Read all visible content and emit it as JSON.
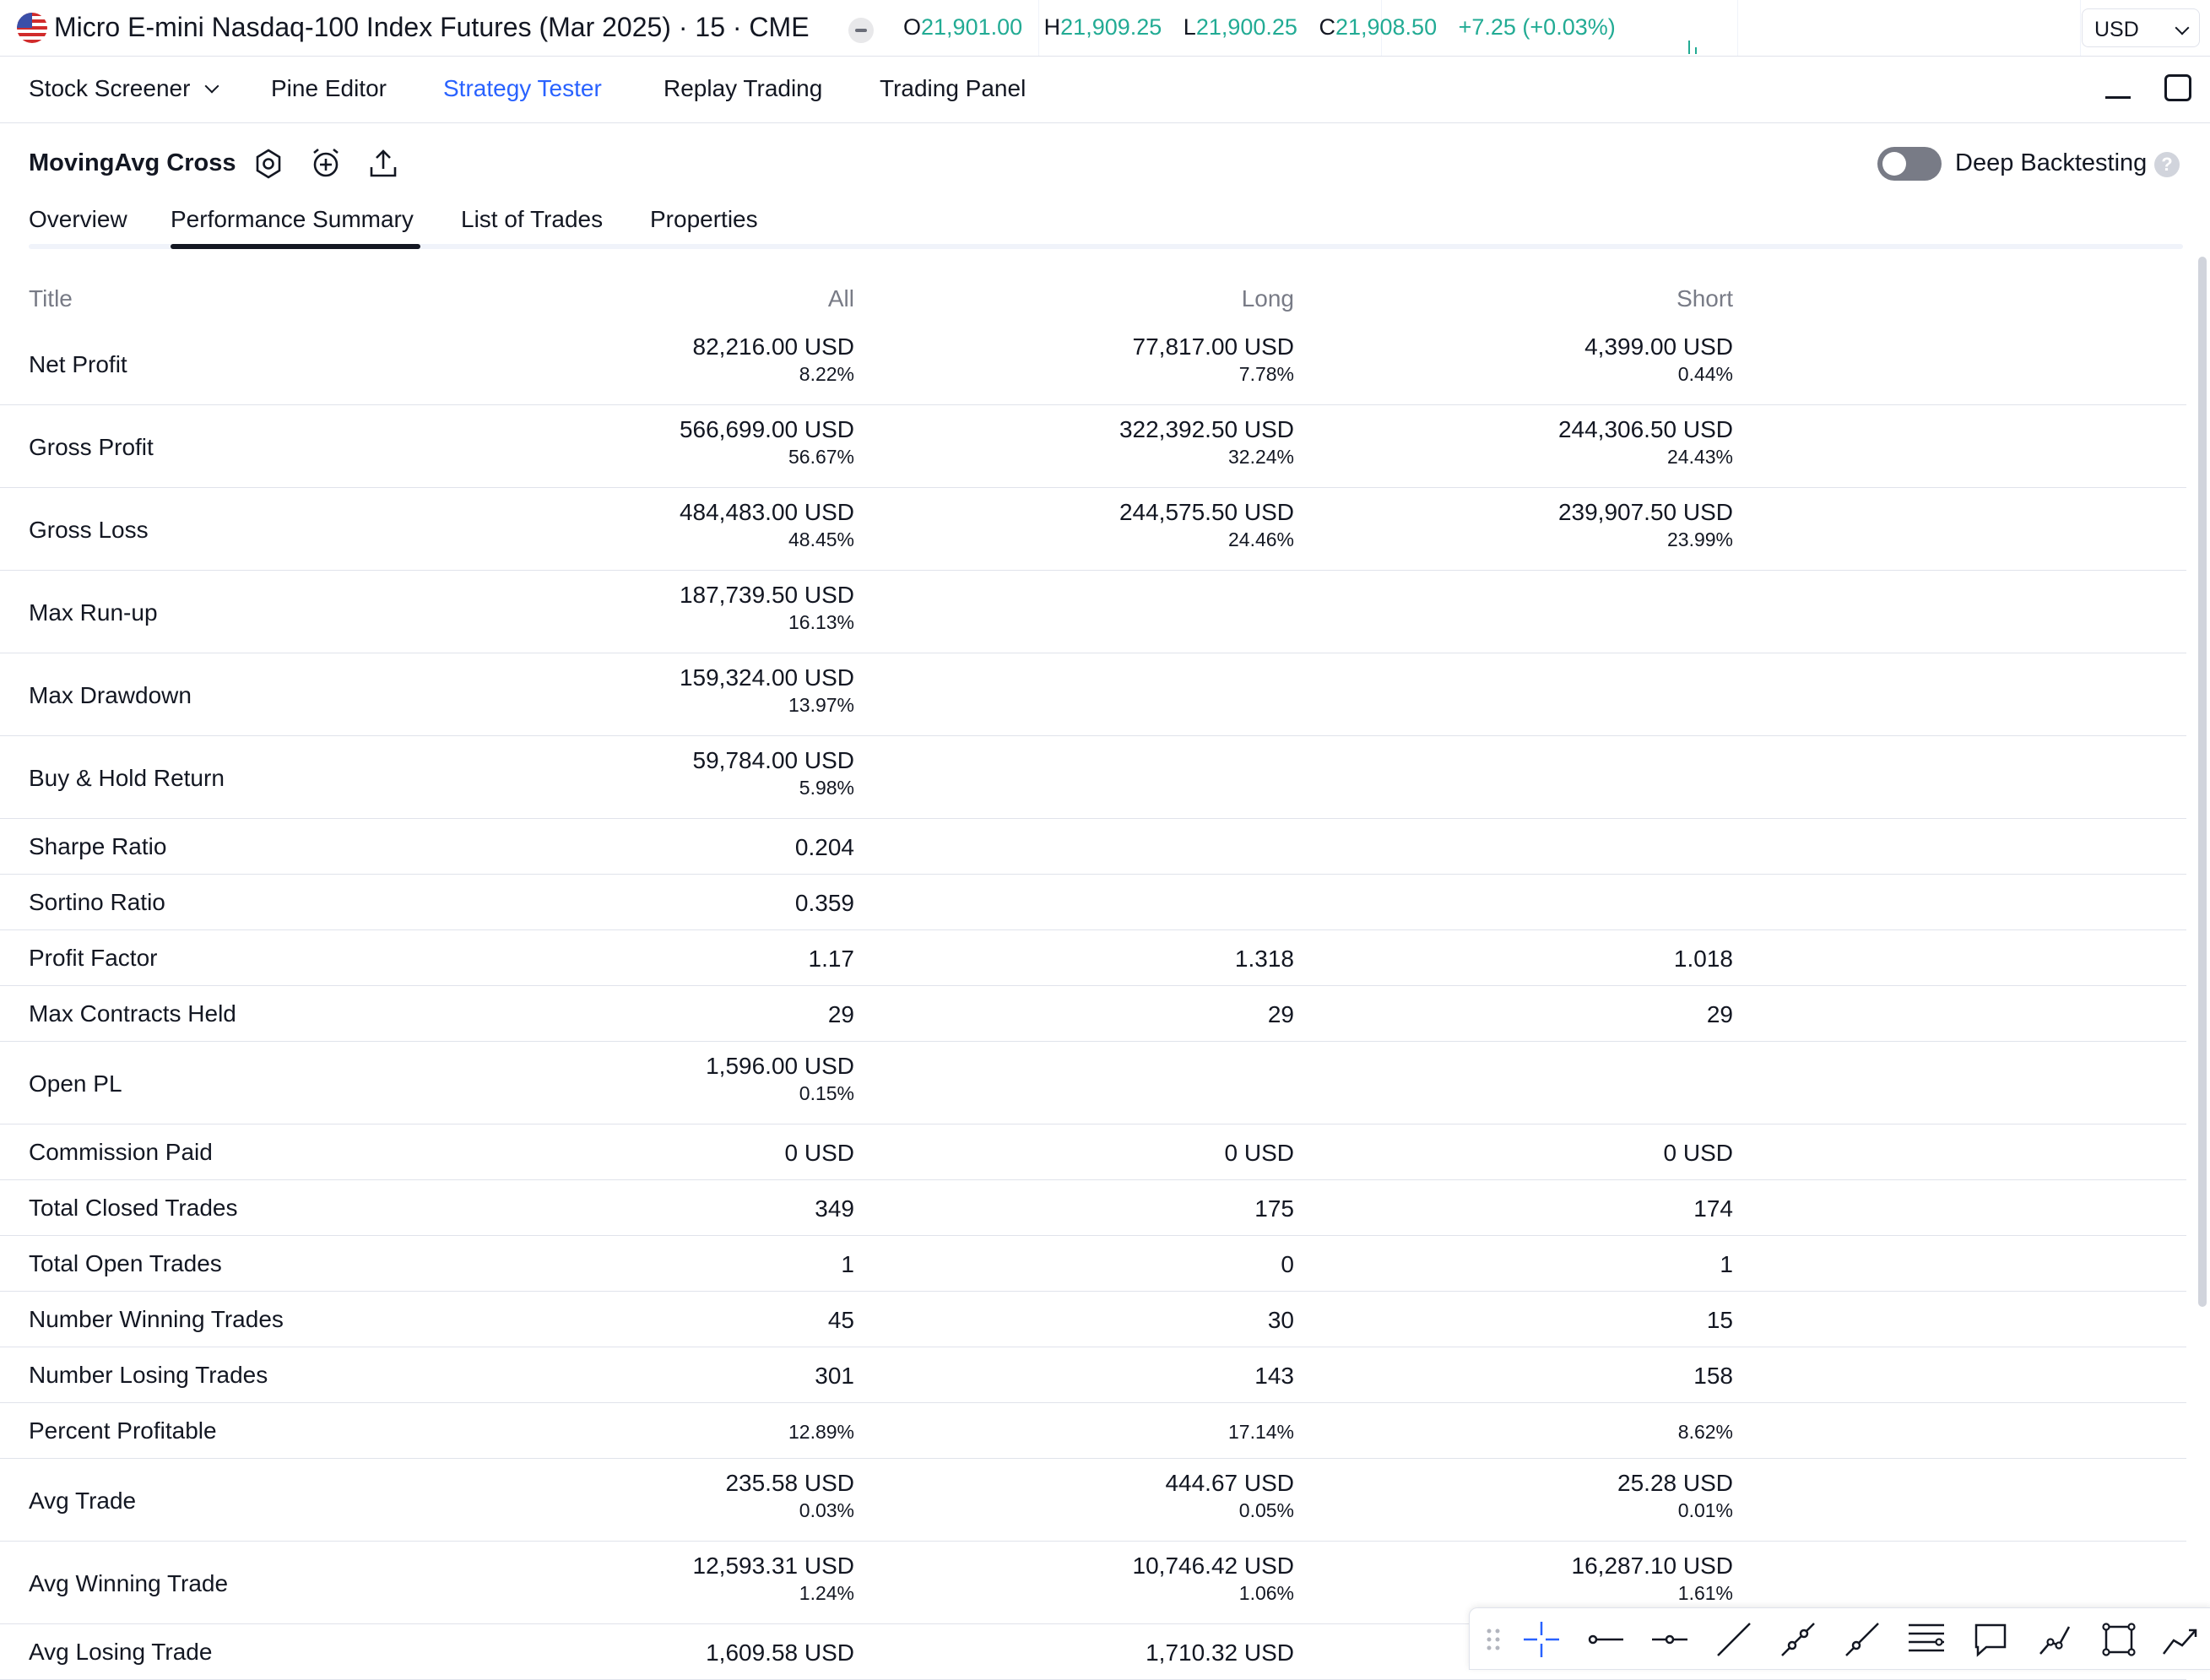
{
  "symbol": {
    "title": "Micro E-mini Nasdaq-100 Index Futures (Mar 2025) · 15 · CME",
    "ohlc": [
      {
        "key": "O",
        "value": "21,901.00"
      },
      {
        "key": "H",
        "value": "21,909.25"
      },
      {
        "key": "L",
        "value": "21,900.25"
      },
      {
        "key": "C",
        "value": "21,908.50"
      }
    ],
    "change": "+7.25 (+0.03%)",
    "currency": "USD"
  },
  "panel_tabs": [
    {
      "label": "Stock Screener"
    },
    {
      "label": "Pine Editor"
    },
    {
      "label": "Strategy Tester"
    },
    {
      "label": "Replay Trading"
    },
    {
      "label": "Trading Panel"
    }
  ],
  "strategy": {
    "name": "MovingAvg Cross",
    "deep_backtesting_label": "Deep Backtesting",
    "help_glyph": "?"
  },
  "sub_tabs": [
    {
      "label": "Overview"
    },
    {
      "label": "Performance Summary"
    },
    {
      "label": "List of Trades"
    },
    {
      "label": "Properties"
    }
  ],
  "table": {
    "headers": {
      "title": "Title",
      "all": "All",
      "long": "Long",
      "short": "Short"
    },
    "rows": [
      {
        "title": "Net Profit",
        "all": "82,216.00 USD",
        "all_pct": "8.22%",
        "long": "77,817.00 USD",
        "long_pct": "7.78%",
        "short": "4,399.00 USD",
        "short_pct": "0.44%"
      },
      {
        "title": "Gross Profit",
        "all": "566,699.00 USD",
        "all_pct": "56.67%",
        "long": "322,392.50 USD",
        "long_pct": "32.24%",
        "short": "244,306.50 USD",
        "short_pct": "24.43%"
      },
      {
        "title": "Gross Loss",
        "all": "484,483.00 USD",
        "all_pct": "48.45%",
        "long": "244,575.50 USD",
        "long_pct": "24.46%",
        "short": "239,907.50 USD",
        "short_pct": "23.99%"
      },
      {
        "title": "Max Run-up",
        "all": "187,739.50 USD",
        "all_pct": "16.13%"
      },
      {
        "title": "Max Drawdown",
        "all": "159,324.00 USD",
        "all_pct": "13.97%"
      },
      {
        "title": "Buy & Hold Return",
        "all": "59,784.00 USD",
        "all_pct": "5.98%"
      },
      {
        "title": "Sharpe Ratio",
        "all": "0.204"
      },
      {
        "title": "Sortino Ratio",
        "all": "0.359"
      },
      {
        "title": "Profit Factor",
        "all": "1.17",
        "long": "1.318",
        "short": "1.018"
      },
      {
        "title": "Max Contracts Held",
        "all": "29",
        "long": "29",
        "short": "29"
      },
      {
        "title": "Open PL",
        "all": "1,596.00 USD",
        "all_pct": "0.15%"
      },
      {
        "title": "Commission Paid",
        "all": "0 USD",
        "long": "0 USD",
        "short": "0 USD"
      },
      {
        "title": "Total Closed Trades",
        "all": "349",
        "long": "175",
        "short": "174"
      },
      {
        "title": "Total Open Trades",
        "all": "1",
        "long": "0",
        "short": "1"
      },
      {
        "title": "Number Winning Trades",
        "all": "45",
        "long": "30",
        "short": "15"
      },
      {
        "title": "Number Losing Trades",
        "all": "301",
        "long": "143",
        "short": "158"
      },
      {
        "title": "Percent Profitable",
        "all_pct": "12.89%",
        "long_pct": "17.14%",
        "short_pct": "8.62%"
      },
      {
        "title": "Avg Trade",
        "all": "235.58 USD",
        "all_pct": "0.03%",
        "long": "444.67 USD",
        "long_pct": "0.05%",
        "short": "25.28 USD",
        "short_pct": "0.01%"
      },
      {
        "title": "Avg Winning Trade",
        "all": "12,593.31 USD",
        "all_pct": "1.24%",
        "long": "10,746.42 USD",
        "long_pct": "1.06%",
        "short": "16,287.10 USD",
        "short_pct": "1.61%"
      },
      {
        "title": "Avg Losing Trade",
        "all": "1,609.58 USD",
        "long": "1,710.32 USD"
      }
    ]
  },
  "colors": {
    "accent": "#2962ff",
    "positive": "#22ab94",
    "text": "#131722",
    "muted": "#787b86",
    "border": "#e0e3eb"
  },
  "drawing_tools": [
    "crosshair-icon",
    "ray-icon",
    "horizontal-ray-icon",
    "trend-line-icon",
    "extended-line-icon",
    "info-line-icon",
    "horizontal-lines-icon",
    "callout-icon",
    "path-icon",
    "rectangle-icon",
    "polyline-icon"
  ]
}
